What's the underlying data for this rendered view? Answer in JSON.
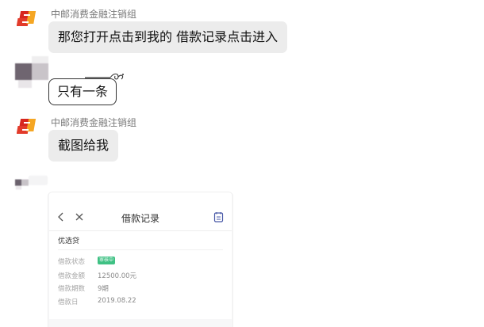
{
  "messages": [
    {
      "sender_name": "中邮消费金融注销组",
      "text": "那您打开点击到我的 借款记录点击进入"
    },
    {
      "text": "只有一条"
    },
    {
      "sender_name": "中邮消费金融注销组",
      "text": "截图给我"
    }
  ],
  "screenshot": {
    "title": "借款记录",
    "section": "优选贷",
    "status_badge": "审核中",
    "rows": [
      {
        "label": "借款状态",
        "value": ""
      },
      {
        "label": "借款金额",
        "value": "12500.00元"
      },
      {
        "label": "借款期数",
        "value": "9期"
      },
      {
        "label": "借款日",
        "value": "2019.08.22"
      }
    ],
    "icons": {
      "back": "chevron-left-icon",
      "close": "close-icon",
      "records": "document-icon"
    }
  },
  "colors": {
    "brand_red": "#d7271f",
    "brand_gold": "#f5a623",
    "bubble_gray": "#ececec",
    "status_green": "#3fc184"
  }
}
